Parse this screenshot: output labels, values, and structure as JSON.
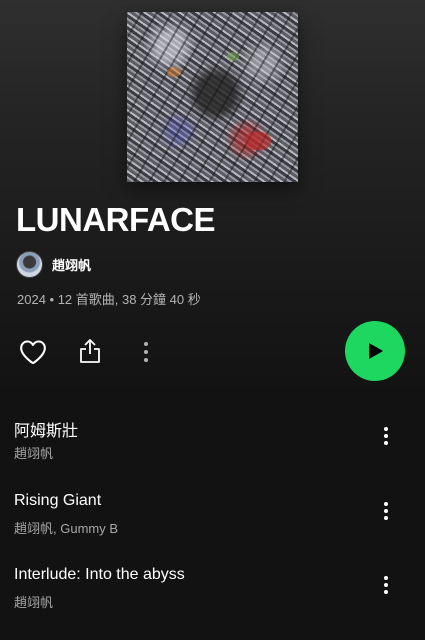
{
  "album": {
    "title": "LUNARFACE",
    "artist": "趙翊帆",
    "meta": "2024 • 12 首歌曲, 38 分鐘 40 秒"
  },
  "actions": {
    "like_icon": "heart-outline-icon",
    "share_icon": "share-icon",
    "more_icon": "more-vertical-icon",
    "play_icon": "play-icon",
    "accent_color": "#1ed760"
  },
  "tracks": [
    {
      "title": "阿姆斯壯",
      "artist": "趙翊帆"
    },
    {
      "title": "Rising Giant",
      "artist": "趙翊帆, Gummy B"
    },
    {
      "title": "Interlude: Into the abyss",
      "artist": "趙翊帆"
    }
  ]
}
